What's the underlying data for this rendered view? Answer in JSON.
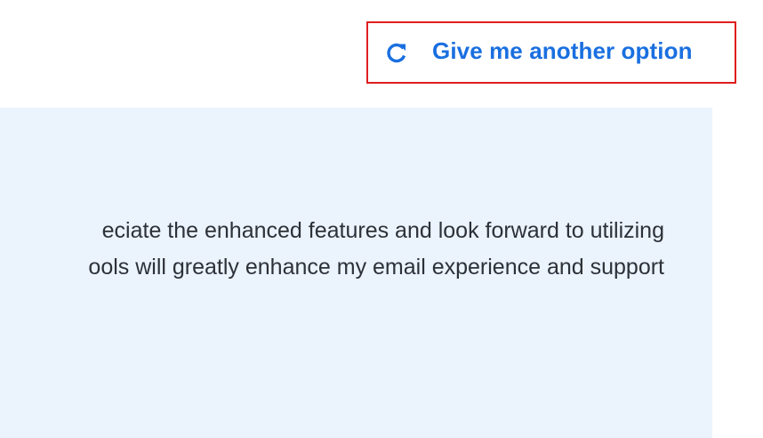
{
  "actions": {
    "another_option_label": "Give me another option",
    "icon": "refresh-icon",
    "accent_color": "#1a6fe0",
    "highlight_color": "#e01e1e"
  },
  "response": {
    "background_color": "#ebf3fd",
    "lines": [
      "eciate the enhanced features and look forward to utilizing",
      "ools will greatly enhance my email experience and support"
    ]
  }
}
